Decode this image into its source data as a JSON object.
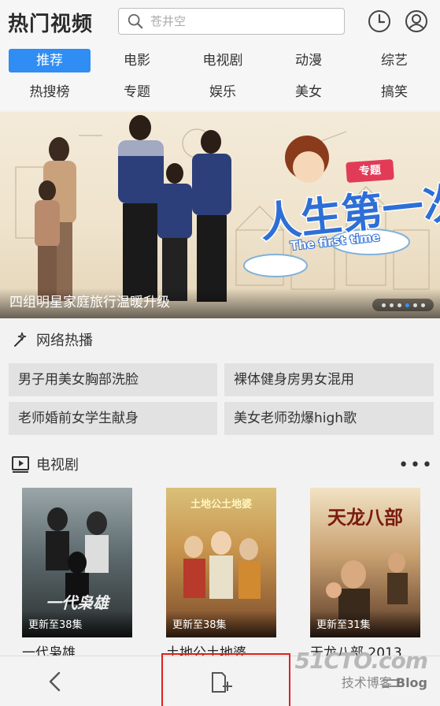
{
  "header": {
    "logo": "热门视频",
    "search_placeholder": "苍井空"
  },
  "categories": [
    "推荐",
    "电影",
    "电视剧",
    "动漫",
    "综艺",
    "热搜榜",
    "专题",
    "娱乐",
    "美女",
    "搞笑"
  ],
  "banner": {
    "caption": "四组明星家庭旅行温暖升级",
    "badge": "专题",
    "title_art": "人生第一次",
    "title_art_en": "The first time",
    "slide_count": 6,
    "active_slide": 4
  },
  "hot_section": {
    "title": "网络热播",
    "items": [
      "男子用美女胸部洗脸",
      "裸体健身房男女混用",
      "老师婚前女学生献身",
      "美女老师劲爆high歌"
    ]
  },
  "tv_section": {
    "title": "电视剧",
    "more": "•••",
    "shows": [
      {
        "title": "一代枭雄",
        "episode": "更新至38集",
        "poster_text": "一代枭雄"
      },
      {
        "title": "土地公土地婆",
        "episode": "更新至38集",
        "poster_text": "土地公土地婆"
      },
      {
        "title": "天龙八部 2013",
        "episode": "更新至31集",
        "poster_text": "天龙八部"
      }
    ]
  },
  "watermark": {
    "site": "51CTO.com",
    "tagline": "技术博客",
    "blog": "Blog"
  },
  "colors": {
    "accent": "#2f8df3",
    "highlight_box": "#e0211b"
  }
}
